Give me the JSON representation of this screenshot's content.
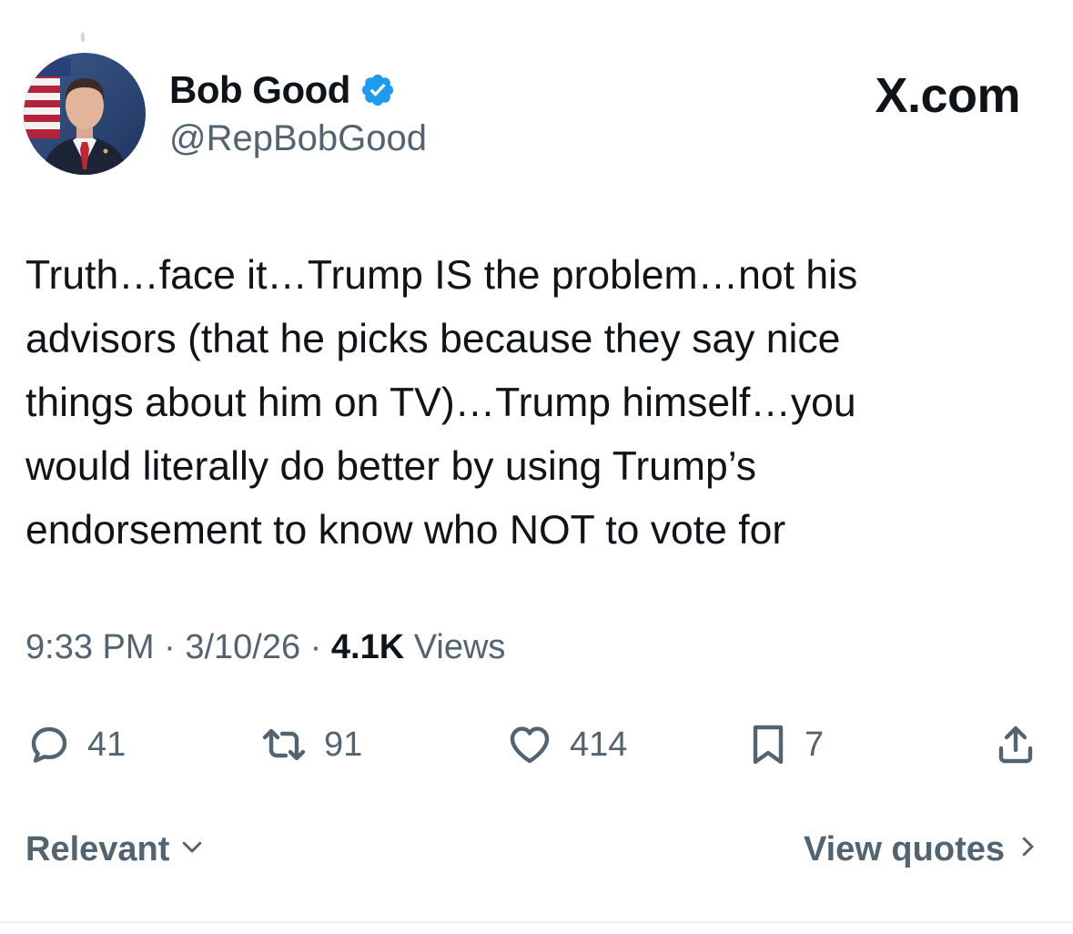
{
  "author": {
    "display_name": "Bob Good",
    "handle": "@RepBobGood",
    "verified": true
  },
  "site_label": "X.com",
  "tweet": {
    "lines": [
      "Truth…face it…Trump IS the problem…not his",
      "advisors (that he picks because they say nice",
      "things about him on TV)…Trump himself…you",
      "would literally do better by using Trump’s",
      "endorsement to know who NOT to vote for"
    ]
  },
  "meta": {
    "time": "9:33 PM",
    "date": "3/10/26",
    "separator": "·",
    "views_count": "4.1K",
    "views_label": "Views"
  },
  "actions": {
    "replies": "41",
    "reposts": "91",
    "likes": "414",
    "bookmarks": "7"
  },
  "footer": {
    "sort_label": "Relevant",
    "quotes_label": "View quotes"
  },
  "icons": {
    "reply": "reply-icon",
    "repost": "repost-icon",
    "like": "heart-icon",
    "bookmark": "bookmark-icon",
    "share": "share-icon",
    "verified": "verified-badge-icon"
  },
  "colors": {
    "text_primary": "#0f1419",
    "text_secondary": "#536471",
    "verified_blue": "#1d9bf0"
  }
}
